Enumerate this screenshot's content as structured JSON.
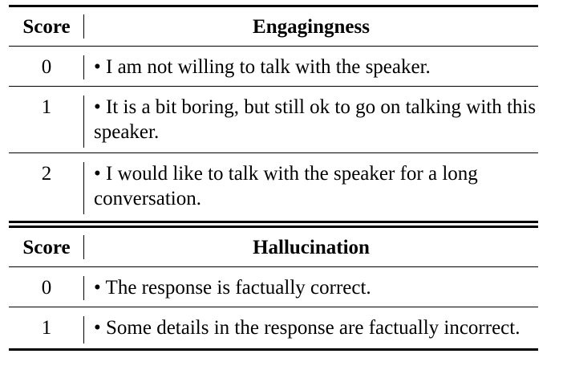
{
  "tables": [
    {
      "score_header": "Score",
      "criterion_header": "Engagingness",
      "rows": [
        {
          "score": "0",
          "text": "• I am not willing to talk with the speaker."
        },
        {
          "score": "1",
          "text": "• It is a bit boring, but still ok to go on talking with this speaker."
        },
        {
          "score": "2",
          "text": "• I would like to talk with the speaker for a long conversation."
        }
      ]
    },
    {
      "score_header": "Score",
      "criterion_header": "Hallucination",
      "rows": [
        {
          "score": "0",
          "text": "• The response is factually correct."
        },
        {
          "score": "1",
          "text": "• Some details in the response are factually incorrect."
        }
      ]
    }
  ]
}
